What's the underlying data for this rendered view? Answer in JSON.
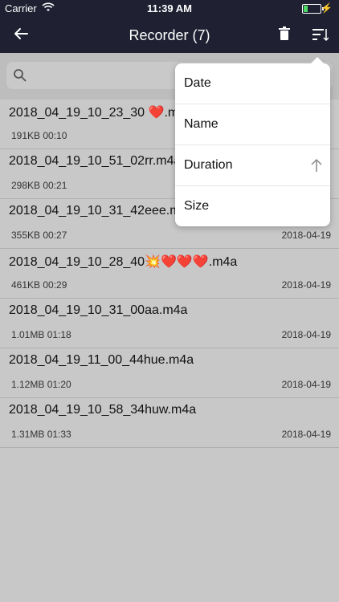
{
  "statusbar": {
    "carrier": "Carrier",
    "time": "11:39 AM",
    "battery_level": 0.2
  },
  "navbar": {
    "title": "Recorder (7)",
    "icons": [
      "back-arrow-icon",
      "trash-icon",
      "sort-icon"
    ]
  },
  "search": {
    "placeholder": ""
  },
  "recordings": [
    {
      "name": "2018_04_19_10_23_30 ❤️.m",
      "meta": "191KB 00:10",
      "date": ""
    },
    {
      "name": "2018_04_19_10_51_02rr.m4a",
      "meta": "298KB 00:21",
      "date": ""
    },
    {
      "name": "2018_04_19_10_31_42eee.m",
      "meta": "355KB 00:27",
      "date": "2018-04-19"
    },
    {
      "name": "2018_04_19_10_28_40💥❤️❤️❤️.m4a",
      "meta": "461KB 00:29",
      "date": "2018-04-19"
    },
    {
      "name": "2018_04_19_10_31_00aa.m4a",
      "meta": "1.01MB 01:18",
      "date": "2018-04-19"
    },
    {
      "name": "2018_04_19_11_00_44hue.m4a",
      "meta": "1.12MB 01:20",
      "date": "2018-04-19"
    },
    {
      "name": "2018_04_19_10_58_34huw.m4a",
      "meta": "1.31MB 01:33",
      "date": "2018-04-19"
    }
  ],
  "sort_menu": {
    "items": [
      {
        "label": "Date"
      },
      {
        "label": "Name"
      },
      {
        "label": "Duration",
        "active": true,
        "direction": "ascending"
      },
      {
        "label": "Size"
      }
    ]
  },
  "colors": {
    "header": "#1f2133",
    "background": "#c8c8c8",
    "menu": "#ffffff"
  }
}
